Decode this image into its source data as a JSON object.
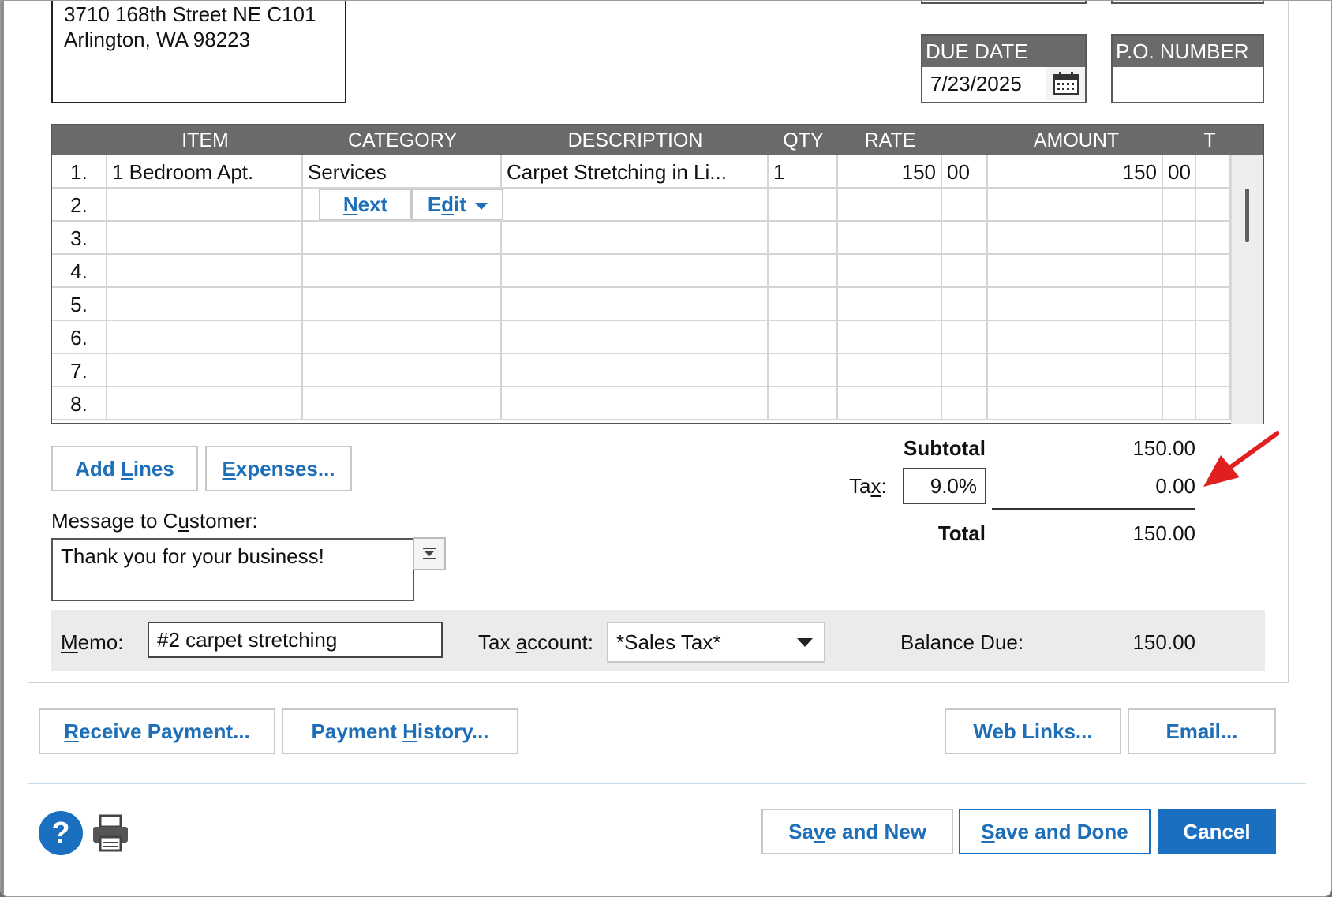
{
  "customer": {
    "address_line1": "3710 168th Street NE C101",
    "address_line2": "Arlington, WA 98223"
  },
  "due_date": {
    "label": "DUE DATE",
    "value": "7/23/2025"
  },
  "po_number": {
    "label": "P.O. NUMBER",
    "value": ""
  },
  "grid": {
    "columns": [
      "ITEM",
      "CATEGORY",
      "DESCRIPTION",
      "QTY",
      "RATE",
      "AMOUNT",
      "T"
    ],
    "rows": [
      {
        "num": "1.",
        "item": "1 Bedroom Apt.",
        "category": "Services",
        "description": "Carpet Stretching in Li...",
        "qty": "1",
        "rate": "150",
        "rate_cents": "00",
        "amount": "150",
        "amount_cents": "00"
      },
      {
        "num": "2."
      },
      {
        "num": "3."
      },
      {
        "num": "4."
      },
      {
        "num": "5."
      },
      {
        "num": "6."
      },
      {
        "num": "7."
      },
      {
        "num": "8."
      }
    ],
    "inline_next": "Next",
    "inline_edit": "Edit"
  },
  "buttons": {
    "add_lines": "Add Lines",
    "expenses": "Expenses...",
    "receive_payment": "Receive Payment...",
    "payment_history": "Payment History...",
    "web_links": "Web Links...",
    "email": "Email...",
    "save_new": "Save and New",
    "save_done": "Save and Done",
    "cancel": "Cancel"
  },
  "totals": {
    "subtotal_label": "Subtotal",
    "subtotal": "150.00",
    "tax_label": "Tax:",
    "tax_rate": "9.0%",
    "tax_amount": "0.00",
    "total_label": "Total",
    "total": "150.00"
  },
  "message": {
    "label": "Message to Customer:",
    "value": "Thank you for your business!"
  },
  "memo": {
    "label": "Memo:",
    "value": "#2 carpet stretching"
  },
  "tax_account": {
    "label": "Tax account:",
    "value": "*Sales Tax*"
  },
  "balance": {
    "label": "Balance Due:",
    "value": "150.00"
  },
  "colors": {
    "accent": "#1a6fc0",
    "header": "#6a6a6a",
    "annotation_arrow": "#e02020"
  },
  "icons": {
    "help": "help-icon",
    "print": "printer-icon",
    "calendar": "calendar-icon"
  }
}
